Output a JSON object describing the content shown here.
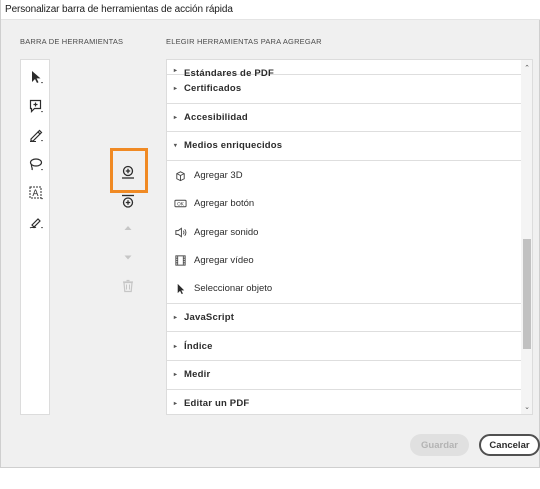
{
  "dialog": {
    "title": "Personalizar barra de herramientas de acción rápida"
  },
  "left_panel": {
    "label": "BARRA DE HERRAMIENTAS",
    "tools": [
      {
        "icon": "select-arrow-icon"
      },
      {
        "icon": "add-comment-icon"
      },
      {
        "icon": "highlight-pen-icon"
      },
      {
        "icon": "lasso-draw-icon"
      },
      {
        "icon": "text-box-icon"
      },
      {
        "icon": "sign-pen-icon"
      }
    ]
  },
  "middle_controls": {
    "add_icon": "add-to-toolbar-icon",
    "separator_icon": "add-separator-icon",
    "up_icon": "move-up-icon",
    "down_icon": "move-down-icon",
    "delete_icon": "trash-icon"
  },
  "right_panel": {
    "label": "ELEGIR HERRAMIENTAS PARA AGREGAR",
    "partial_group": "Estándares de PDF",
    "groups_before": [
      "Certificados",
      "Accesibilidad"
    ],
    "expanded_group": "Medios enriquecidos",
    "expanded_items": [
      {
        "label": "Agregar 3D",
        "icon": "cube-icon"
      },
      {
        "label": "Agregar botón",
        "icon": "ok-button-icon"
      },
      {
        "label": "Agregar sonido",
        "icon": "speaker-icon"
      },
      {
        "label": "Agregar vídeo",
        "icon": "film-icon"
      },
      {
        "label": "Seleccionar objeto",
        "icon": "pointer-icon"
      }
    ],
    "groups_after": [
      "JavaScript",
      "Índice",
      "Medir",
      "Editar un PDF"
    ]
  },
  "footer": {
    "save_label": "Guardar",
    "cancel_label": "Cancelar"
  },
  "colors": {
    "highlight": "#f08a24",
    "dialog_bg": "#f0f0f0"
  }
}
